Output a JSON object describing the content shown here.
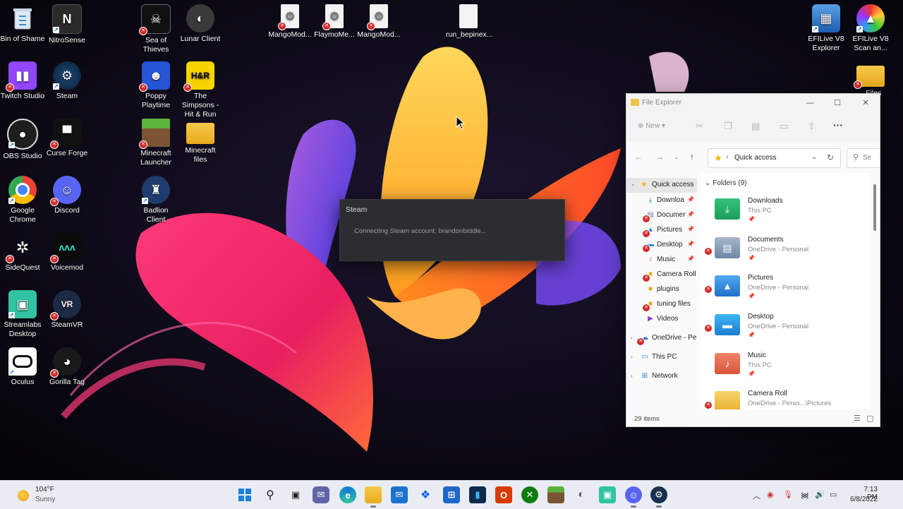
{
  "desktop": {
    "icons": [
      {
        "label": "Bin of Shame"
      },
      {
        "label": "NitroSense"
      },
      {
        "label": "Twitch Studio"
      },
      {
        "label": "Steam"
      },
      {
        "label": "OBS Studio"
      },
      {
        "label": "Curse Forge"
      },
      {
        "label": "Google Chrome"
      },
      {
        "label": "Discord"
      },
      {
        "label": "SideQuest"
      },
      {
        "label": "Voicemod"
      },
      {
        "label": "Streamlabs Desktop"
      },
      {
        "label": "SteamVR"
      },
      {
        "label": "Oculus"
      },
      {
        "label": "Gorilla Tag"
      },
      {
        "label": "Sea of Thieves"
      },
      {
        "label": "Lunar Client"
      },
      {
        "label": "Poppy Playtime"
      },
      {
        "label": "The Simpsons - Hit & Run"
      },
      {
        "label": "Minecraft Launcher"
      },
      {
        "label": "Minecraft files"
      },
      {
        "label": "Badlion Client"
      },
      {
        "label": "MangoMod..."
      },
      {
        "label": "FlaymoMe..."
      },
      {
        "label": "MangoMod..."
      },
      {
        "label": "run_bepinex..."
      },
      {
        "label": "EFILive V8 Explorer"
      },
      {
        "label": "EFILive V8 Scan an..."
      },
      {
        "label": "...Files"
      }
    ]
  },
  "steam_dialog": {
    "title": "Steam",
    "message": "Connecting Steam account: brandonbiddle..."
  },
  "explorer": {
    "title": "File Explorer",
    "toolbar": {
      "new_label": "New"
    },
    "address": {
      "location": "Quick access"
    },
    "search": {
      "placeholder": "Se"
    },
    "nav": {
      "quick_access": "Quick access",
      "items": [
        {
          "label": "Downloa"
        },
        {
          "label": "Documer"
        },
        {
          "label": "Pictures"
        },
        {
          "label": "Desktop"
        },
        {
          "label": "Music"
        },
        {
          "label": "Camera Roll"
        },
        {
          "label": "plugins"
        },
        {
          "label": "tuning files"
        },
        {
          "label": "Videos"
        }
      ],
      "onedrive": "OneDrive - Pe",
      "this_pc": "This PC",
      "network": "Network"
    },
    "content": {
      "folders_header": "Folders (9)",
      "folders": [
        {
          "name": "Downloads",
          "location": "This PC"
        },
        {
          "name": "Documents",
          "location": "OneDrive - Personal"
        },
        {
          "name": "Pictures",
          "location": "OneDrive - Personal"
        },
        {
          "name": "Desktop",
          "location": "OneDrive - Personal"
        },
        {
          "name": "Music",
          "location": "This PC"
        },
        {
          "name": "Camera Roll",
          "location": "OneDrive - Perso...\\Pictures"
        }
      ]
    },
    "status": {
      "items_count": "29 items"
    }
  },
  "taskbar": {
    "weather": {
      "temp": "104°F",
      "condition": "Sunny"
    },
    "clock": {
      "time": "7:13 PM",
      "date": "6/8/2022"
    }
  },
  "colors": {
    "taskbar_bg": "#e9edf3",
    "explorer_bg": "#fafafa",
    "steam_dialog_bg": "#2b2d30",
    "error_badge": "#d42a2a"
  }
}
